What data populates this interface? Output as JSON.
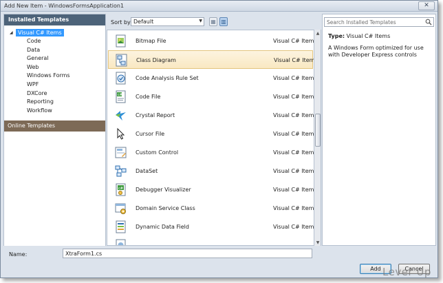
{
  "window": {
    "title": "Add New Item - WindowsFormsApplication1",
    "close_label": "✕"
  },
  "left_pane": {
    "installed_header": "Installed Templates",
    "root": "Visual C# Items",
    "children": [
      "Code",
      "Data",
      "General",
      "Web",
      "Windows Forms",
      "WPF",
      "DXCore",
      "Reporting",
      "Workflow"
    ],
    "online_header": "Online Templates"
  },
  "toolbar": {
    "sort_label": "Sort by:",
    "sort_value": "Default"
  },
  "items": [
    {
      "name": "Bitmap File",
      "lang": "Visual C# Items",
      "icon": "bitmap-file-icon"
    },
    {
      "name": "Class Diagram",
      "lang": "Visual C# Items",
      "icon": "class-diagram-icon",
      "selected": true
    },
    {
      "name": "Code Analysis Rule Set",
      "lang": "Visual C# Items",
      "icon": "code-analysis-icon"
    },
    {
      "name": "Code File",
      "lang": "Visual C# Items",
      "icon": "code-file-icon"
    },
    {
      "name": "Crystal Report",
      "lang": "Visual C# Items",
      "icon": "crystal-report-icon"
    },
    {
      "name": "Cursor File",
      "lang": "Visual C# Items",
      "icon": "cursor-file-icon"
    },
    {
      "name": "Custom Control",
      "lang": "Visual C# Items",
      "icon": "custom-control-icon"
    },
    {
      "name": "DataSet",
      "lang": "Visual C# Items",
      "icon": "dataset-icon"
    },
    {
      "name": "Debugger Visualizer",
      "lang": "Visual C# Items",
      "icon": "debugger-visualizer-icon"
    },
    {
      "name": "Domain Service Class",
      "lang": "Visual C# Items",
      "icon": "domain-service-icon"
    },
    {
      "name": "Dynamic Data Field",
      "lang": "Visual C# Items",
      "icon": "dynamic-data-icon"
    },
    {
      "name": "",
      "lang": "",
      "icon": "html-page-icon"
    }
  ],
  "right_pane": {
    "search_placeholder": "Search Installed Templates",
    "type_label": "Type:",
    "type_value": "Visual C# Items",
    "description": "A Windows Form optimized for use with Developer Express controls"
  },
  "bottom": {
    "name_label": "Name:",
    "name_value": "XtraForm1.cs",
    "add_label": "Add",
    "cancel_label": "Cancel"
  },
  "watermark": "Lever Up"
}
